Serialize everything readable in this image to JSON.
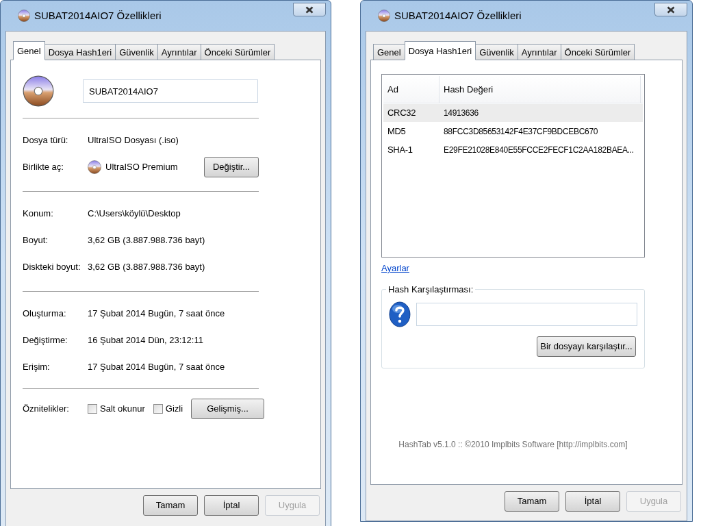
{
  "windows": [
    {
      "kind": "general",
      "title": "SUBAT2014AIO7 Özellikleri",
      "tabs": [
        {
          "label": "Genel",
          "selected": true
        },
        {
          "label": "Dosya Hash1eri",
          "selected": false
        },
        {
          "label": "Güvenlik",
          "selected": false
        },
        {
          "label": "Ayrıntılar",
          "selected": false
        },
        {
          "label": "Önceki Sürümler",
          "selected": false
        }
      ],
      "file_name": "SUBAT2014AIO7",
      "sections": [
        [
          {
            "kind": "text",
            "label": "Dosya türü:",
            "value": "UltraISO Dosyası (.iso)"
          },
          {
            "kind": "app",
            "label": "Birlikte aç:",
            "value": "UltraISO Premium",
            "button": "Değiştir..."
          }
        ],
        [
          {
            "kind": "text",
            "label": "Konum:",
            "value": "C:\\Users\\köylü\\Desktop"
          },
          {
            "kind": "text",
            "label": "Boyut:",
            "value": "3,62 GB (3.887.988.736 bayt)"
          },
          {
            "kind": "text",
            "label": "Diskteki boyut:",
            "value": "3,62 GB (3.887.988.736 bayt)"
          }
        ],
        [
          {
            "kind": "text",
            "label": "Oluşturma:",
            "value": "17 Şubat 2014 Bugün, 7 saat önce"
          },
          {
            "kind": "text",
            "label": "Değiştirme:",
            "value": "16 Şubat 2014 Dün, 23:12:11"
          },
          {
            "kind": "text",
            "label": "Erişim:",
            "value": "17 Şubat 2014 Bugün, 7 saat önce"
          }
        ]
      ],
      "attributes": {
        "label": "Öznitelikler:",
        "checkboxes": [
          {
            "label": "Salt okunur",
            "checked": false
          },
          {
            "label": "Gizli",
            "checked": false
          }
        ],
        "button": "Gelişmiş..."
      },
      "buttons": [
        {
          "label": "Tamam",
          "disabled": false
        },
        {
          "label": "İptal",
          "disabled": false
        },
        {
          "label": "Uygula",
          "disabled": true
        }
      ]
    },
    {
      "kind": "hashes",
      "title": "SUBAT2014AIO7 Özellikleri",
      "tabs": [
        {
          "label": "Genel",
          "selected": false
        },
        {
          "label": "Dosya Hash1eri",
          "selected": true
        },
        {
          "label": "Güvenlik",
          "selected": false
        },
        {
          "label": "Ayrıntılar",
          "selected": false
        },
        {
          "label": "Önceki Sürümler",
          "selected": false
        }
      ],
      "hash_table": {
        "columns": [
          "Ad",
          "Hash Değeri"
        ],
        "rows": [
          {
            "cells": [
              "CRC32",
              "14913636"
            ],
            "selected": true
          },
          {
            "cells": [
              "MD5",
              "88FCC3D85653142F4E37CF9BDCEBC670"
            ],
            "selected": false
          },
          {
            "cells": [
              "SHA-1",
              "E29FE21028E840E55FCCE2FECF1C2AA182BAEA..."
            ],
            "selected": false
          }
        ]
      },
      "settings_link": "Ayarlar",
      "compare": {
        "title": "Hash Karşılaştırması:",
        "button": "Bir dosyayı karşılaştır..."
      },
      "footer": "HashTab v5.1.0 :: ©2010 Implbits Software [http://implbits.com]",
      "buttons": [
        {
          "label": "Tamam",
          "disabled": false
        },
        {
          "label": "İptal",
          "disabled": false
        },
        {
          "label": "Uygula",
          "disabled": true
        }
      ]
    }
  ]
}
